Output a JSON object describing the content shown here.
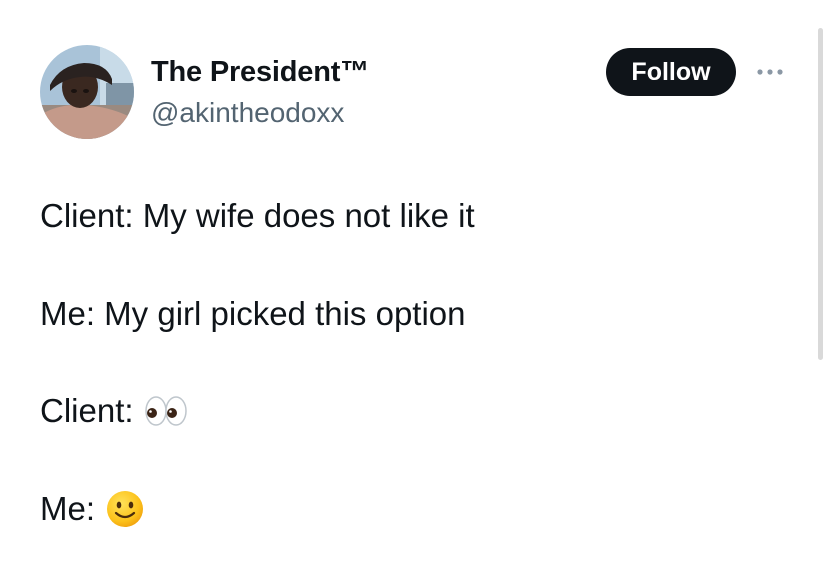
{
  "author": {
    "display_name": "The President™",
    "handle": "@akintheodoxx",
    "avatar_icon": "profile-photo"
  },
  "actions": {
    "follow_label": "Follow",
    "more_icon": "more-horizontal-icon"
  },
  "tweet": {
    "lines": [
      {
        "text": "Client: My wife does not like it",
        "emoji": ""
      },
      {
        "text": "Me: My girl picked this option",
        "emoji": ""
      },
      {
        "text": "Client:",
        "emoji": "eyes-emoji"
      },
      {
        "text": "Me:",
        "emoji": "slightly-smiling-face-emoji"
      }
    ]
  },
  "colors": {
    "text_primary": "#0f1419",
    "text_secondary": "#536471",
    "button_bg": "#0f1419",
    "button_text": "#ffffff"
  }
}
